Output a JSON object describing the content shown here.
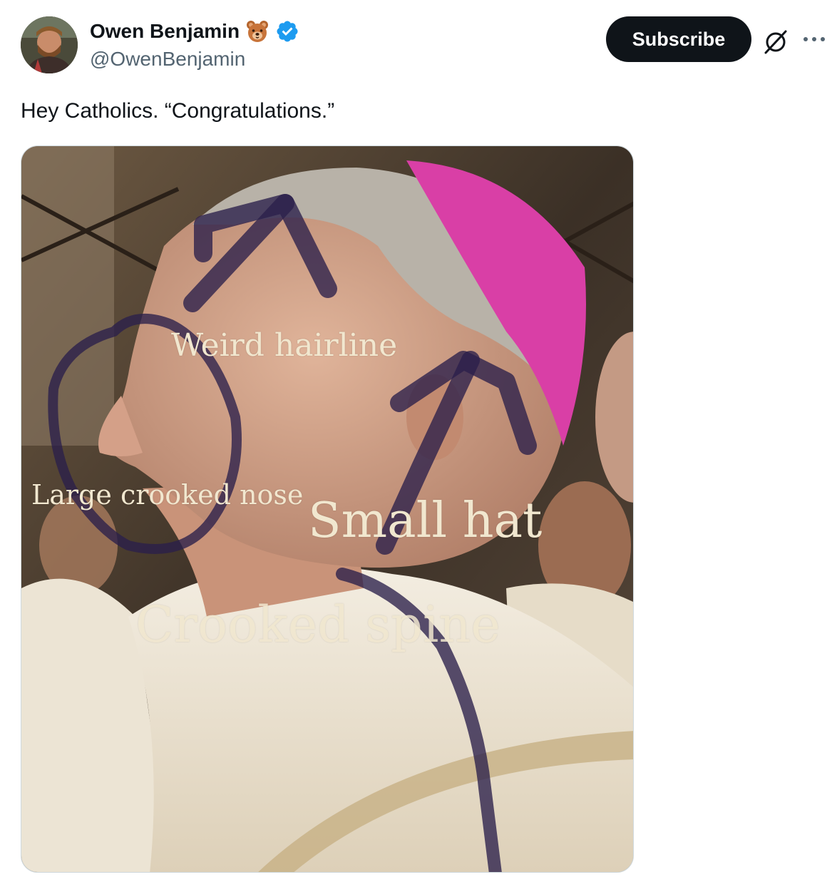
{
  "author": {
    "display_name": "Owen Benjamin",
    "handle": "@OwenBenjamin",
    "emoji_icon": "bear-face-icon",
    "verified_icon": "verified-badge-icon",
    "verified_color": "#1d9bf0"
  },
  "actions": {
    "subscribe_label": "Subscribe",
    "grok_icon": "grok-icon",
    "more_icon": "more-options-icon"
  },
  "tweet": {
    "text": "Hey Catholics. “Congratulations.”"
  },
  "image_captions": {
    "hairline": "Weird hairline",
    "nose": "Large crooked nose",
    "hat": "Small hat",
    "spine": "Crooked spine"
  },
  "colors": {
    "text_primary": "#0f1419",
    "text_secondary": "#536471",
    "button_bg": "#0f1419",
    "hat_magenta": "#d93fa6",
    "marker": "#2a1f4a",
    "caption": "#f1e7cf"
  }
}
